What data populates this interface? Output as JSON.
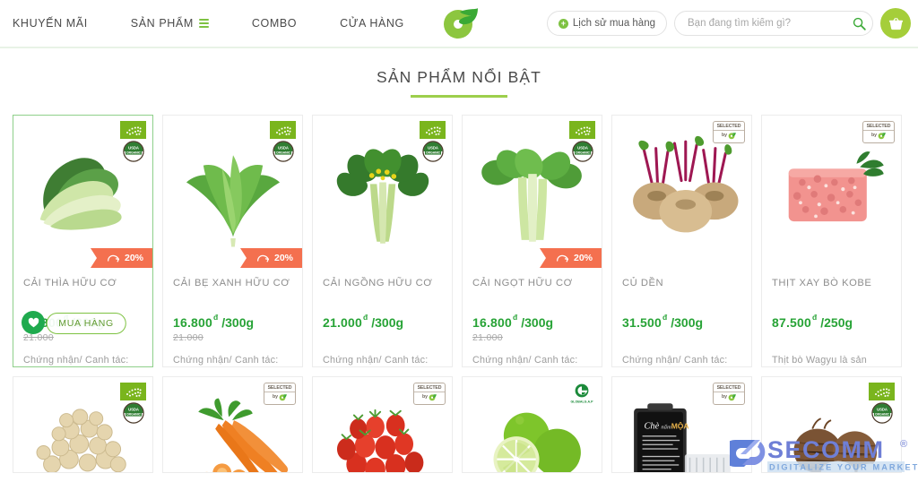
{
  "header": {
    "nav": [
      {
        "label": "KHUYẾN MÃI",
        "icon": null
      },
      {
        "label": "SẢN PHẨM",
        "icon": "hamburger-icon"
      },
      {
        "label": "COMBO",
        "icon": null
      },
      {
        "label": "CỬA HÀNG",
        "icon": null
      }
    ],
    "logo_name": "organic-leaf-logo",
    "history_label": "Lịch sử mua hàng",
    "search": {
      "value": "",
      "placeholder": "Bạn đang tìm kiếm gì?"
    },
    "search_icon": "search-icon",
    "cart_icon": "shopping-basket-icon"
  },
  "section": {
    "title": "SẢN PHẨM NỔI BẬT",
    "accent_color": "#9dcf4c"
  },
  "overlay_actions": {
    "favorite_icon": "heart-icon",
    "buy_label": "MUA HÀNG"
  },
  "colors": {
    "price_green": "#27a336",
    "ribbon_orange": "#f4704f",
    "brand_green": "#7ec242",
    "cart_green": "#a5ce3a",
    "active_card_border": "#8ed08a"
  },
  "products_row1": [
    {
      "name": "CẢI THÌA HỮU CƠ",
      "price": "16.800",
      "currency": "đ",
      "unit": "/300g",
      "old_price": "21.000",
      "discount": "20%",
      "desc": "Chứng nhận/ Canh tác:",
      "badges": [
        "eu-organic-badge",
        "usda-organic-badge"
      ],
      "image": "bok-choy",
      "active": true
    },
    {
      "name": "CẢI BẸ XANH HỮU CƠ",
      "price": "16.800",
      "currency": "đ",
      "unit": "/300g",
      "old_price": "21.000",
      "discount": "20%",
      "desc": "Chứng nhận/ Canh tác:",
      "badges": [
        "eu-organic-badge",
        "usda-organic-badge"
      ],
      "image": "mustard-greens",
      "active": false
    },
    {
      "name": "CẢI NGỒNG HỮU CƠ",
      "price": "21.000",
      "currency": "đ",
      "unit": "/300g",
      "old_price": "",
      "discount": "",
      "desc": "Chứng nhận/ Canh tác:",
      "badges": [
        "eu-organic-badge",
        "usda-organic-badge"
      ],
      "image": "choy-sum",
      "active": false
    },
    {
      "name": "CẢI NGỌT HỮU CƠ",
      "price": "16.800",
      "currency": "đ",
      "unit": "/300g",
      "old_price": "21.000",
      "discount": "20%",
      "desc": "Chứng nhận/ Canh tác:",
      "badges": [
        "eu-organic-badge",
        "usda-organic-badge"
      ],
      "image": "sweet-greens",
      "active": false
    },
    {
      "name": "CỦ DỀN",
      "price": "31.500",
      "currency": "đ",
      "unit": "/300g",
      "old_price": "",
      "discount": "",
      "desc": "Chứng nhận/ Canh tác:",
      "badges": [
        "selected-by-badge"
      ],
      "image": "beetroot",
      "active": false
    },
    {
      "name": "THỊT XAY BÒ KOBE",
      "price": "87.500",
      "currency": "đ",
      "unit": "/250g",
      "old_price": "",
      "discount": "",
      "desc": "Thịt bò Wagyu là sản",
      "badges": [
        "selected-by-badge"
      ],
      "image": "ground-beef",
      "active": false
    }
  ],
  "products_row2": [
    {
      "image": "chickpeas",
      "badges": [
        "eu-organic-badge",
        "usda-organic-badge"
      ]
    },
    {
      "image": "carrots",
      "badges": [
        "selected-by-badge"
      ]
    },
    {
      "image": "cherry-tomatoes",
      "badges": [
        "selected-by-badge"
      ]
    },
    {
      "image": "limes",
      "badges": [
        "globalgap-badge"
      ]
    },
    {
      "image": "packaged-mushrooms",
      "badges": [
        "selected-by-badge"
      ]
    },
    {
      "image": "taro-root",
      "badges": [
        "eu-organic-badge",
        "usda-organic-badge"
      ]
    }
  ],
  "badge_text": {
    "selected": "SELECTED",
    "by": "by",
    "globalgap": "GLOBALG.A.P"
  },
  "watermark": {
    "brand": "SECOMM",
    "registered": "®",
    "tagline": "DIGITALIZE YOUR MARKET"
  }
}
